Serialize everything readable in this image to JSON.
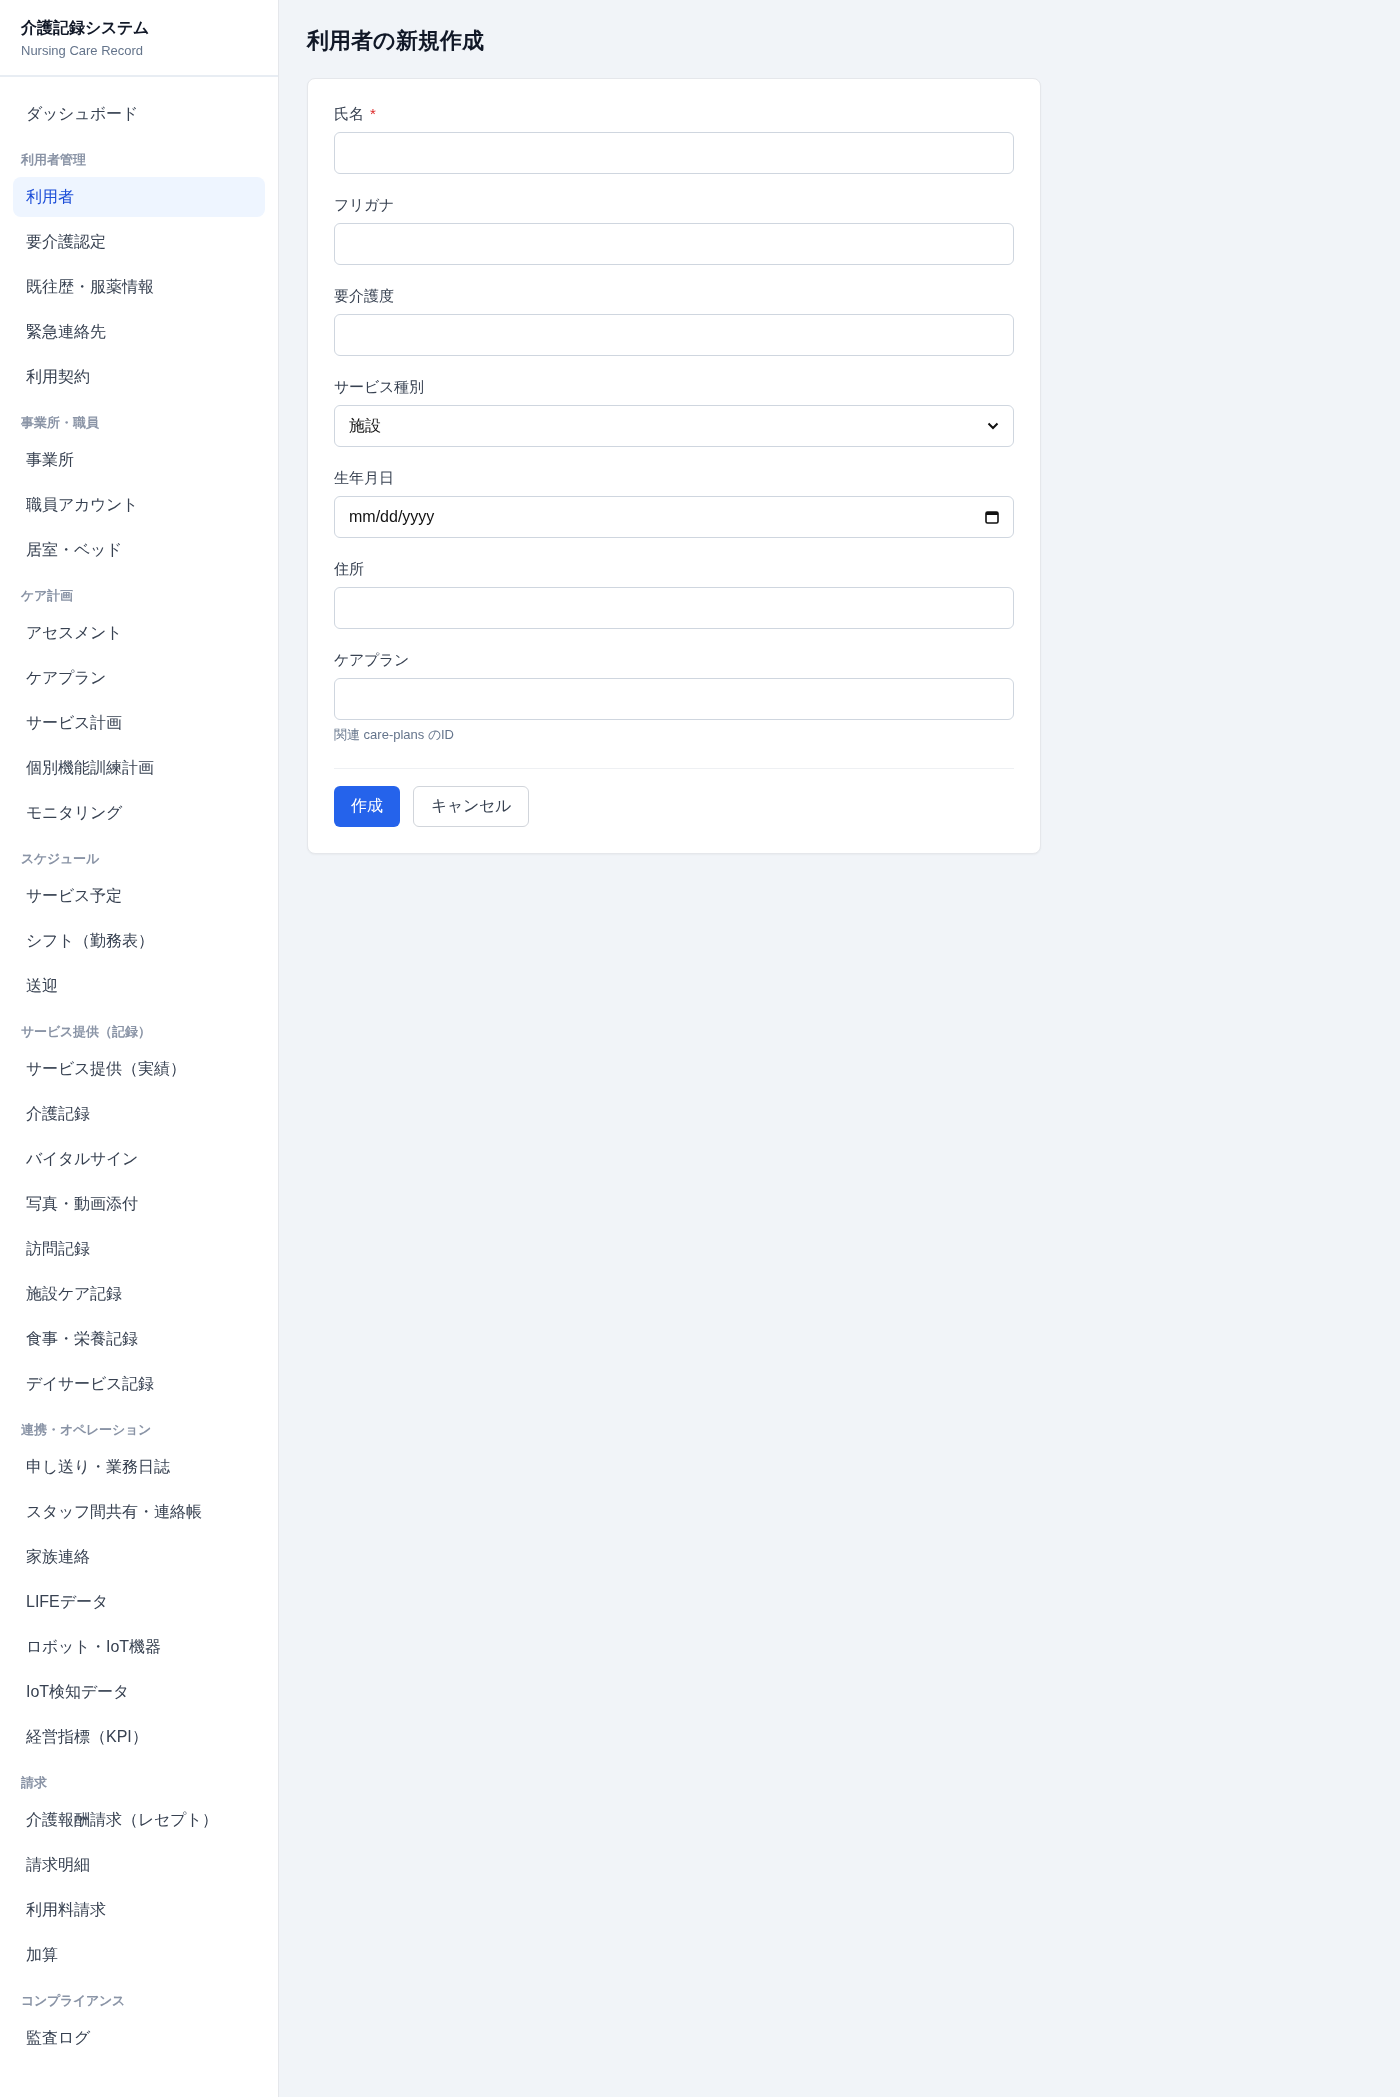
{
  "sidebar": {
    "title": "介護記録システム",
    "subtitle": "Nursing Care Record",
    "sections": [
      {
        "items": [
          {
            "label": "ダッシュボード",
            "selected": false
          }
        ]
      },
      {
        "label": "利用者管理",
        "items": [
          {
            "label": "利用者",
            "selected": true
          },
          {
            "label": "要介護認定",
            "selected": false
          },
          {
            "label": "既往歴・服薬情報",
            "selected": false
          },
          {
            "label": "緊急連絡先",
            "selected": false
          },
          {
            "label": "利用契約",
            "selected": false
          }
        ]
      },
      {
        "label": "事業所・職員",
        "items": [
          {
            "label": "事業所",
            "selected": false
          },
          {
            "label": "職員アカウント",
            "selected": false
          },
          {
            "label": "居室・ベッド",
            "selected": false
          }
        ]
      },
      {
        "label": "ケア計画",
        "items": [
          {
            "label": "アセスメント",
            "selected": false
          },
          {
            "label": "ケアプラン",
            "selected": false
          },
          {
            "label": "サービス計画",
            "selected": false
          },
          {
            "label": "個別機能訓練計画",
            "selected": false
          },
          {
            "label": "モニタリング",
            "selected": false
          }
        ]
      },
      {
        "label": "スケジュール",
        "items": [
          {
            "label": "サービス予定",
            "selected": false
          },
          {
            "label": "シフト（勤務表）",
            "selected": false
          },
          {
            "label": "送迎",
            "selected": false
          }
        ]
      },
      {
        "label": "サービス提供（記録）",
        "items": [
          {
            "label": "サービス提供（実績）",
            "selected": false
          },
          {
            "label": "介護記録",
            "selected": false
          },
          {
            "label": "バイタルサイン",
            "selected": false
          },
          {
            "label": "写真・動画添付",
            "selected": false
          },
          {
            "label": "訪問記録",
            "selected": false
          },
          {
            "label": "施設ケア記録",
            "selected": false
          },
          {
            "label": "食事・栄養記録",
            "selected": false
          },
          {
            "label": "デイサービス記録",
            "selected": false
          }
        ]
      },
      {
        "label": "連携・オペレーション",
        "items": [
          {
            "label": "申し送り・業務日誌",
            "selected": false
          },
          {
            "label": "スタッフ間共有・連絡帳",
            "selected": false
          },
          {
            "label": "家族連絡",
            "selected": false
          },
          {
            "label": "LIFEデータ",
            "selected": false
          },
          {
            "label": "ロボット・IoT機器",
            "selected": false
          },
          {
            "label": "IoT検知データ",
            "selected": false
          },
          {
            "label": "経営指標（KPI）",
            "selected": false
          }
        ]
      },
      {
        "label": "請求",
        "items": [
          {
            "label": "介護報酬請求（レセプト）",
            "selected": false
          },
          {
            "label": "請求明細",
            "selected": false
          },
          {
            "label": "利用料請求",
            "selected": false
          },
          {
            "label": "加算",
            "selected": false
          }
        ]
      },
      {
        "label": "コンプライアンス",
        "items": [
          {
            "label": "監査ログ",
            "selected": false
          }
        ]
      }
    ]
  },
  "page": {
    "title": "利用者の新規作成",
    "fields": [
      {
        "kind": "text",
        "label": "氏名",
        "required_mark": "*"
      },
      {
        "kind": "text",
        "label": "フリガナ"
      },
      {
        "kind": "text",
        "label": "要介護度"
      },
      {
        "kind": "select",
        "label": "サービス種別",
        "value": "施設"
      },
      {
        "kind": "date",
        "label": "生年月日",
        "placeholder": "mm/dd/yyyy"
      },
      {
        "kind": "text",
        "label": "住所"
      },
      {
        "kind": "text",
        "label": "ケアプラン",
        "help": "関連 care-plans のID"
      }
    ],
    "buttons": [
      {
        "kind": "primary",
        "label": "作成"
      },
      {
        "kind": "secondary",
        "label": "キャンセル"
      }
    ]
  }
}
